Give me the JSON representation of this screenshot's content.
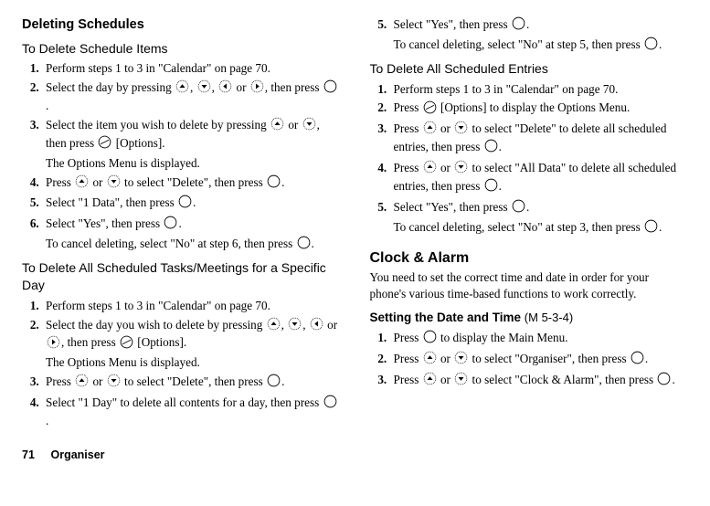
{
  "left": {
    "heading": "Deleting Schedules",
    "sub_items": "To Delete Schedule Items",
    "steps_items": [
      "Perform steps 1 to 3 in \"Calendar\" on page 70.",
      "Select the day by pressing {up-d}, {down-d}, {left-d} or {right-d}, then press {centre}.",
      "Select the item you wish to delete by pressing {up-d} or {down-d}, then press {softkey} [Options].\nThe Options Menu is displayed.",
      "Press {up-d} or {down-d} to select \"Delete\", then press {centre}.",
      "Select \"1 Data\", then press {centre}.",
      "Select \"Yes\", then press {centre}.\nTo cancel deleting, select \"No\" at step 6, then press {centre}."
    ],
    "sub_specific": "To Delete All Scheduled Tasks/Meetings for a Specific Day",
    "steps_specific": [
      "Perform steps 1 to 3 in \"Calendar\" on page 70.",
      "Select the day you wish to delete by pressing {up-d}, {down-d}, {left-d} or {right-d}, then press {softkey} [Options].\nThe Options Menu is displayed.",
      "Press {up-d} or {down-d} to select \"Delete\", then press {centre}.",
      "Select \"1 Day\" to delete all contents for a day, then press {centre}."
    ]
  },
  "right": {
    "steps_cont": [
      "Select \"Yes\", then press {centre}.\nTo cancel deleting, select \"No\" at step 5, then press {centre}."
    ],
    "sub_all": "To Delete All Scheduled Entries",
    "steps_all": [
      "Perform steps 1 to 3 in \"Calendar\" on page 70.",
      "Press {softkey} [Options] to display the Options Menu.",
      "Press {up-d} or {down-d} to select \"Delete\" to delete all scheduled entries, then press {centre}.",
      "Press {up-d} or {down-d} to select \"All Data\" to delete all scheduled entries, then press {centre}.",
      "Select \"Yes\", then press {centre}.\nTo cancel deleting, select \"No\" at step 3, then press {centre}."
    ],
    "clock_heading": "Clock & Alarm",
    "clock_intro": "You need to set the correct time and date in order for your phone's various time-based functions to work correctly.",
    "setting_heading": "Setting the Date and Time",
    "menu_code": "(M 5-3-4)",
    "steps_clock": [
      "Press {centre} to display the Main Menu.",
      "Press {up-d} or {down-d} to select \"Organiser\", then press {centre}.",
      "Press {up-d} or {down-d} to select \"Clock & Alarm\", then press {centre}."
    ]
  },
  "footer": {
    "page": "71",
    "section": "Organiser"
  }
}
